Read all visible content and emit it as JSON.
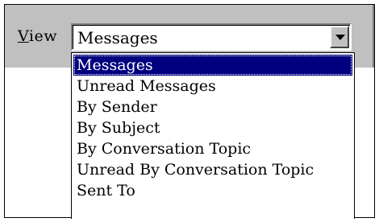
{
  "toolbar": {
    "view_label_mnemonic": "V",
    "view_label_rest": "iew"
  },
  "combo": {
    "selected": "Messages",
    "button_icon": "chevron-down-icon"
  },
  "dropdown": {
    "options": [
      "Messages",
      "Unread Messages",
      "By Sender",
      "By Subject",
      "By Conversation Topic",
      "Unread By Conversation Topic",
      "Sent To"
    ],
    "highlighted_index": 0
  },
  "colors": {
    "face": "#c0c0c0",
    "highlight": "#000080",
    "highlight_text": "#ffffff"
  }
}
